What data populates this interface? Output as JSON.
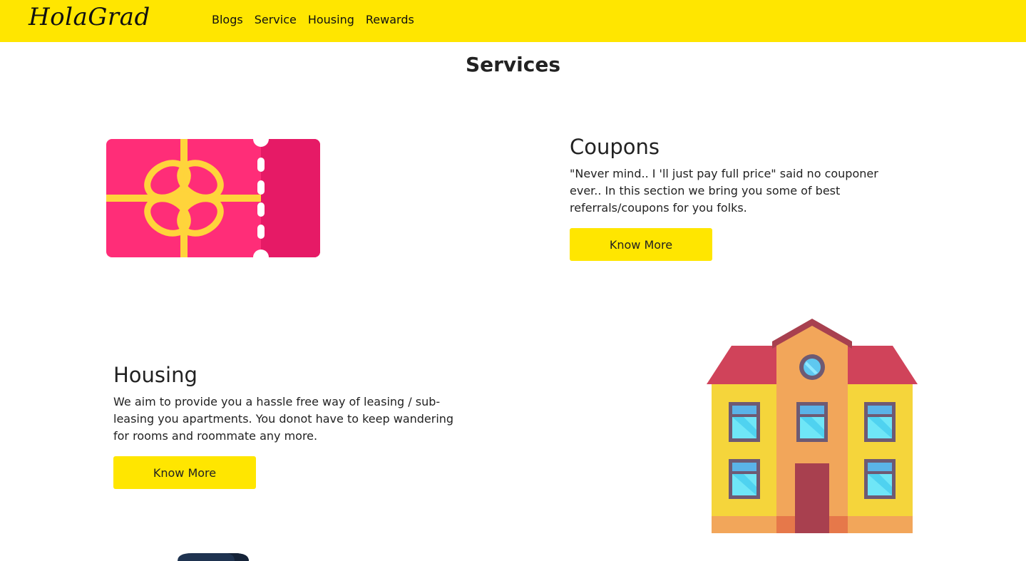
{
  "navbar": {
    "brand": "HolaGrad",
    "links": [
      "Blogs",
      "Service",
      "Housing",
      "Rewards"
    ]
  },
  "page": {
    "title": "Services"
  },
  "sections": [
    {
      "title": "Coupons",
      "text": "\"Never mind.. I 'll just pay full price\" said no couponer ever.. In this section we bring you some of best referrals/coupons for you folks.",
      "button": "Know More",
      "icon": "gift-coupon-icon"
    },
    {
      "title": "Housing",
      "text": "We aim to provide you a hassle free way of leasing / sub-leasing you apartments. You donot have to keep wandering for rooms and roommate any more.",
      "button": "Know More",
      "icon": "house-icon"
    }
  ],
  "colors": {
    "accent": "#ffe600",
    "coupon_pink": "#ff2d78",
    "coupon_ribbon": "#ffd43b",
    "roof": "#d0435a",
    "wall": "#f5d53b",
    "tower": "#f2a65a"
  }
}
